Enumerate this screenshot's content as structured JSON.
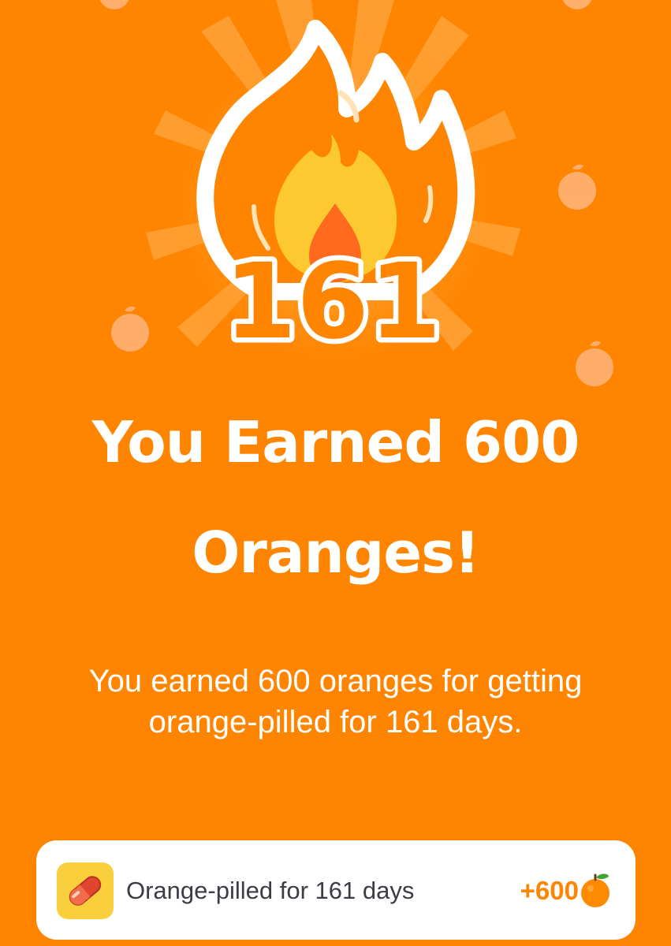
{
  "streak": {
    "count": "161"
  },
  "headline": {
    "line1": "You Earned 600",
    "line2": "Oranges!"
  },
  "description": "You earned 600 oranges for getting orange-pilled for 161 days.",
  "reward": {
    "icon": "pill-icon",
    "label": "Orange-pilled for 161 days",
    "amount": "+600",
    "currency_icon": "orange-fruit-icon"
  },
  "colors": {
    "background": "#ff8400",
    "flame_outline": "#ffffff",
    "flame_inner": "#fdc930",
    "flame_core": "#ff6a1f",
    "card_background": "#ffffff",
    "icon_box": "#f9cf3e",
    "amount": "#ff8400"
  }
}
